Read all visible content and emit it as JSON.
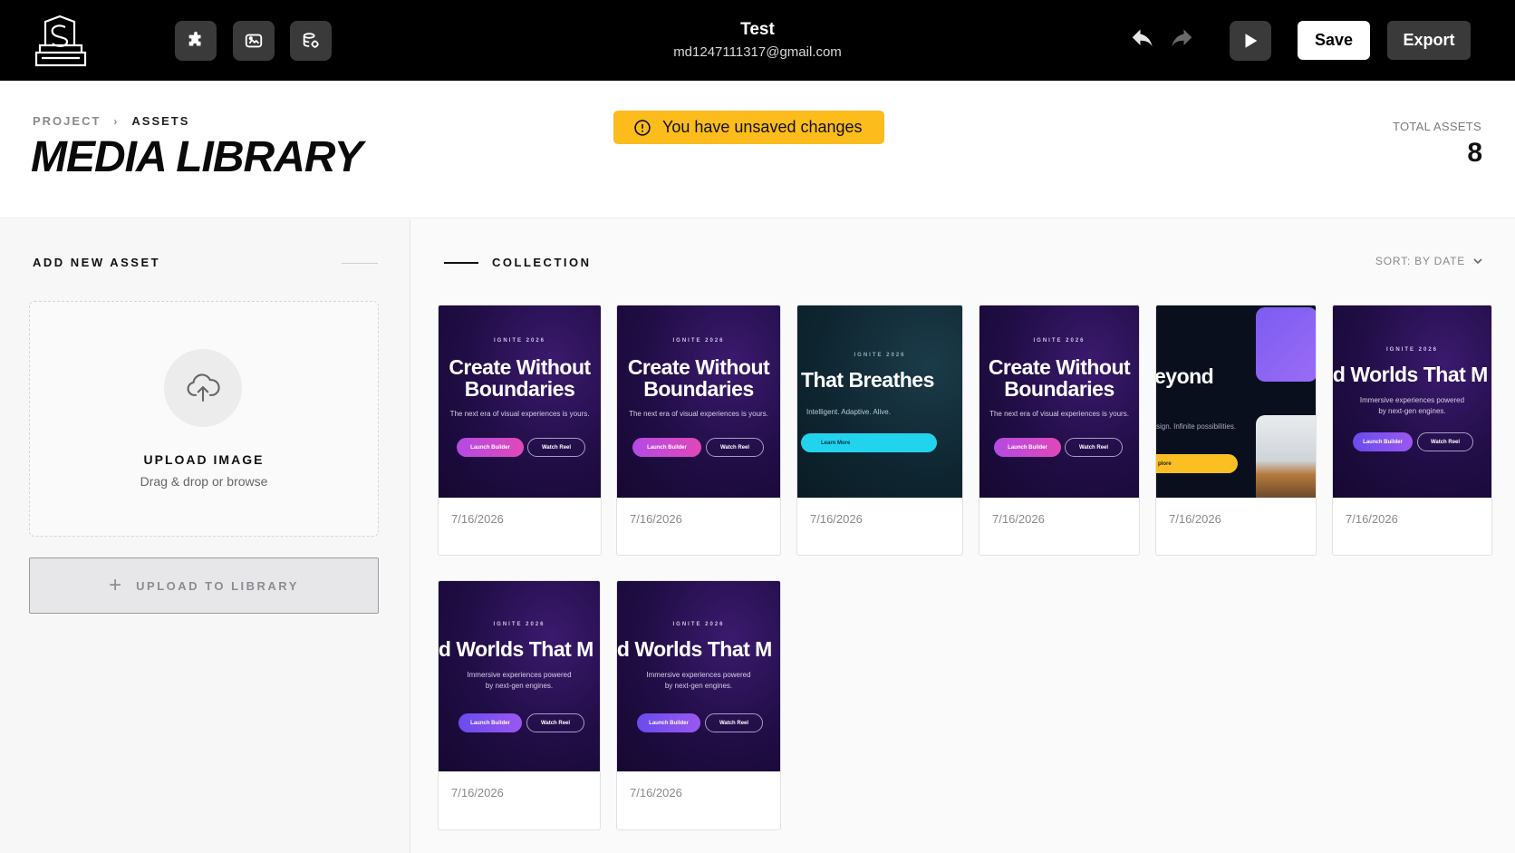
{
  "app": {
    "title": "Test",
    "email": "md1247111317@gmail.com",
    "save_label": "Save",
    "export_label": "Export",
    "toolbar_icons": [
      "puzzle-icon",
      "gamepad-icon",
      "database-icon"
    ]
  },
  "header": {
    "breadcrumb": {
      "project": "PROJECT",
      "separator": "›",
      "current": "ASSETS"
    },
    "page_title": "MEDIA LIBRARY",
    "unsaved_text": "You have unsaved changes",
    "total_label": "TOTAL ASSETS",
    "total_value": "8"
  },
  "sidebar": {
    "title": "ADD NEW ASSET",
    "upload_title": "UPLOAD IMAGE",
    "upload_sub": "Drag & drop or browse",
    "upload_button": "UPLOAD TO LIBRARY"
  },
  "collection": {
    "title": "COLLECTION",
    "sort_label": "SORT: BY DATE",
    "assets": [
      {
        "date": "7/16/2026",
        "kicker": "IGNITE 2026",
        "headline1": "Create Without",
        "headline2": "Boundaries",
        "sub": "The next era of visual experiences is yours.",
        "btn1": "Launch Builder",
        "btn2": "Watch Reel"
      },
      {
        "date": "7/16/2026",
        "kicker": "IGNITE 2026",
        "headline1": "Create Without",
        "headline2": "Boundaries",
        "sub": "The next era of visual experiences is yours.",
        "btn1": "Launch Builder",
        "btn2": "Watch Reel"
      },
      {
        "date": "7/16/2026",
        "kicker": "IGNITE 2026",
        "headline1": "That Breathes",
        "sub": "Intelligent. Adaptive. Alive.",
        "btn1": "Learn More"
      },
      {
        "date": "7/16/2026",
        "kicker": "IGNITE 2026",
        "headline1": "Create Without",
        "headline2": "Boundaries",
        "sub": "The next era of visual experiences is yours.",
        "btn1": "Launch Builder",
        "btn2": "Watch Reel"
      },
      {
        "date": "7/16/2026",
        "headline1": "eyond",
        "sub": "sign. Infinite possibilities.",
        "btn1": "plore"
      },
      {
        "date": "7/16/2026",
        "kicker": "IGNITE 2026",
        "headline1": "ld Worlds That M",
        "sub1": "Immersive experiences powered",
        "sub2": "by next-gen engines.",
        "btn1": "Launch Builder",
        "btn2": "Watch Reel"
      },
      {
        "date": "7/16/2026",
        "kicker": "IGNITE 2026",
        "headline1": "ld Worlds That M",
        "sub1": "Immersive experiences powered",
        "sub2": "by next-gen engines.",
        "btn1": "Launch Builder",
        "btn2": "Watch Reel"
      },
      {
        "date": "7/16/2026",
        "kicker": "IGNITE 2026",
        "headline1": "ld Worlds That M",
        "sub1": "Immersive experiences powered",
        "sub2": "by next-gen engines.",
        "btn1": "Launch Builder",
        "btn2": "Watch Reel"
      }
    ]
  },
  "colors": {
    "topbar": "#000000",
    "unsaved_banner": "#fbbc1c",
    "accent_cyan": "#22d3ee",
    "accent_yellow": "#fbbf24"
  }
}
